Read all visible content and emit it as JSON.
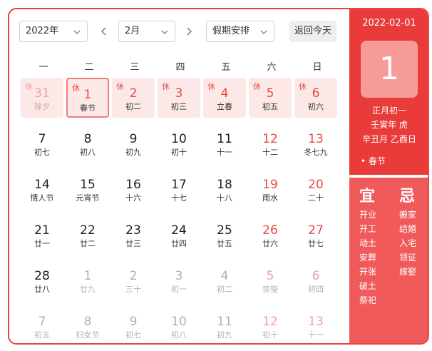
{
  "toolbar": {
    "year": "2022年",
    "month": "2月",
    "holiday": "假期安排",
    "today": "返回今天"
  },
  "weekdays": [
    "一",
    "二",
    "三",
    "四",
    "五",
    "六",
    "日"
  ],
  "rows": [
    [
      {
        "n": "31",
        "l": "除夕",
        "tag": "休",
        "dim": true,
        "hol": true
      },
      {
        "n": "1",
        "l": "春节",
        "tag": "休",
        "hol": true,
        "sel": true
      },
      {
        "n": "2",
        "l": "初二",
        "tag": "休",
        "hol": true
      },
      {
        "n": "3",
        "l": "初三",
        "tag": "休",
        "hol": true
      },
      {
        "n": "4",
        "l": "立春",
        "tag": "休",
        "hol": true
      },
      {
        "n": "5",
        "l": "初五",
        "tag": "休",
        "hol": true
      },
      {
        "n": "6",
        "l": "初六",
        "tag": "休",
        "hol": true
      }
    ],
    [
      {
        "n": "7",
        "l": "初七"
      },
      {
        "n": "8",
        "l": "初八"
      },
      {
        "n": "9",
        "l": "初九"
      },
      {
        "n": "10",
        "l": "初十"
      },
      {
        "n": "11",
        "l": "十一"
      },
      {
        "n": "12",
        "l": "十二",
        "red": true
      },
      {
        "n": "13",
        "l": "冬七九",
        "red": true
      }
    ],
    [
      {
        "n": "14",
        "l": "情人节"
      },
      {
        "n": "15",
        "l": "元宵节"
      },
      {
        "n": "16",
        "l": "十六"
      },
      {
        "n": "17",
        "l": "十七"
      },
      {
        "n": "18",
        "l": "十八"
      },
      {
        "n": "19",
        "l": "雨水",
        "red": true
      },
      {
        "n": "20",
        "l": "二十",
        "red": true
      }
    ],
    [
      {
        "n": "21",
        "l": "廿一"
      },
      {
        "n": "22",
        "l": "廿二"
      },
      {
        "n": "23",
        "l": "廿三"
      },
      {
        "n": "24",
        "l": "廿四"
      },
      {
        "n": "25",
        "l": "廿五"
      },
      {
        "n": "26",
        "l": "廿六",
        "red": true
      },
      {
        "n": "27",
        "l": "廿七",
        "red": true
      }
    ],
    [
      {
        "n": "28",
        "l": "廿八"
      },
      {
        "n": "1",
        "l": "廿九",
        "dim": true
      },
      {
        "n": "2",
        "l": "三十",
        "dim": true
      },
      {
        "n": "3",
        "l": "初一",
        "dim": true
      },
      {
        "n": "4",
        "l": "初二",
        "dim": true
      },
      {
        "n": "5",
        "l": "惊蛰",
        "dim": true,
        "red": true
      },
      {
        "n": "6",
        "l": "初四",
        "dim": true,
        "red": true
      }
    ],
    [
      {
        "n": "7",
        "l": "初五",
        "dim": true
      },
      {
        "n": "8",
        "l": "妇女节",
        "dim": true
      },
      {
        "n": "9",
        "l": "初七",
        "dim": true
      },
      {
        "n": "10",
        "l": "初八",
        "dim": true
      },
      {
        "n": "11",
        "l": "初九",
        "dim": true
      },
      {
        "n": "12",
        "l": "初十",
        "dim": true,
        "red": true
      },
      {
        "n": "13",
        "l": "十一",
        "dim": true,
        "red": true
      }
    ]
  ],
  "panel": {
    "date": "2022-02-01",
    "day": "1",
    "lunar": "正月初一",
    "year_gz": "壬寅年 虎",
    "month_day_gz": "辛丑月 乙酉日",
    "festival": "• 春节",
    "yi_title": "宜",
    "ji_title": "忌",
    "yi": [
      "开业",
      "开工",
      "动土",
      "安葬",
      "开张",
      "破土",
      "祭祀"
    ],
    "ji": [
      "搬家",
      "结婚",
      "入宅",
      "领证",
      "嫁娶"
    ]
  },
  "colors": {
    "accent": "#ea3b3b",
    "holiday_bg": "#fde8e8",
    "dim": "#b0b0b0"
  }
}
